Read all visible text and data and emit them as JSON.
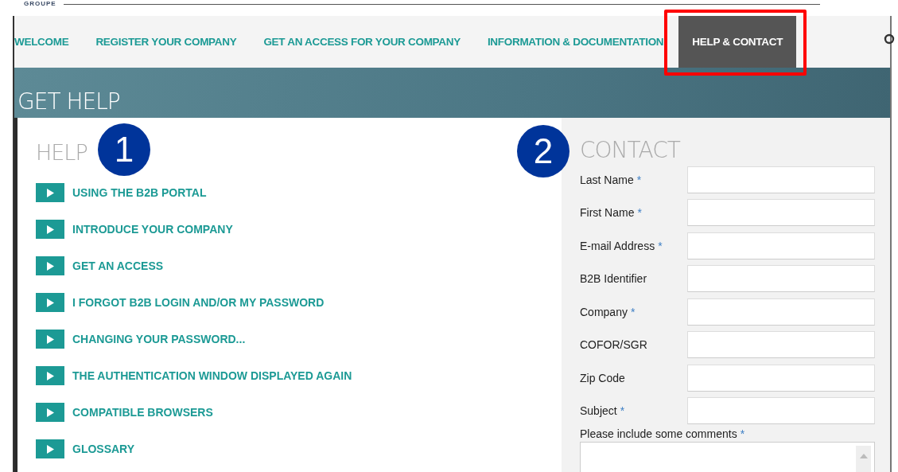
{
  "logo": {
    "text": "GROUPE"
  },
  "nav": [
    {
      "label": "WELCOME",
      "selected": false
    },
    {
      "label": "REGISTER YOUR COMPANY",
      "selected": false
    },
    {
      "label": "GET AN ACCESS FOR YOUR COMPANY",
      "selected": false
    },
    {
      "label": "INFORMATION & DOCUMENTATION",
      "selected": false
    },
    {
      "label": "HELP & CONTACT",
      "selected": true
    }
  ],
  "banner": {
    "title": "GET HELP"
  },
  "help": {
    "title": "HELP",
    "callout": "1",
    "items": [
      {
        "label": "USING THE B2B PORTAL"
      },
      {
        "label": "INTRODUCE YOUR COMPANY"
      },
      {
        "label": "GET AN ACCESS"
      },
      {
        "label": "I FORGOT B2B LOGIN AND/OR MY PASSWORD"
      },
      {
        "label": "CHANGING YOUR PASSWORD..."
      },
      {
        "label": "THE AUTHENTICATION WINDOW DISPLAYED AGAIN"
      },
      {
        "label": "COMPATIBLE BROWSERS"
      },
      {
        "label": "GLOSSARY"
      }
    ]
  },
  "contact": {
    "title": "CONTACT",
    "callout": "2",
    "fields": [
      {
        "label": "Last Name",
        "required_mark": "*"
      },
      {
        "label": "First Name",
        "required_mark": "*"
      },
      {
        "label": "E-mail Address",
        "required_mark": "*"
      },
      {
        "label": "B2B Identifier"
      },
      {
        "label": "Company",
        "required_mark": "*"
      },
      {
        "label": "COFOR/SGR"
      },
      {
        "label": "Zip Code"
      },
      {
        "label": "Subject",
        "required_mark": "*"
      }
    ],
    "comments": {
      "label": "Please include some comments",
      "required_mark": "*"
    }
  }
}
